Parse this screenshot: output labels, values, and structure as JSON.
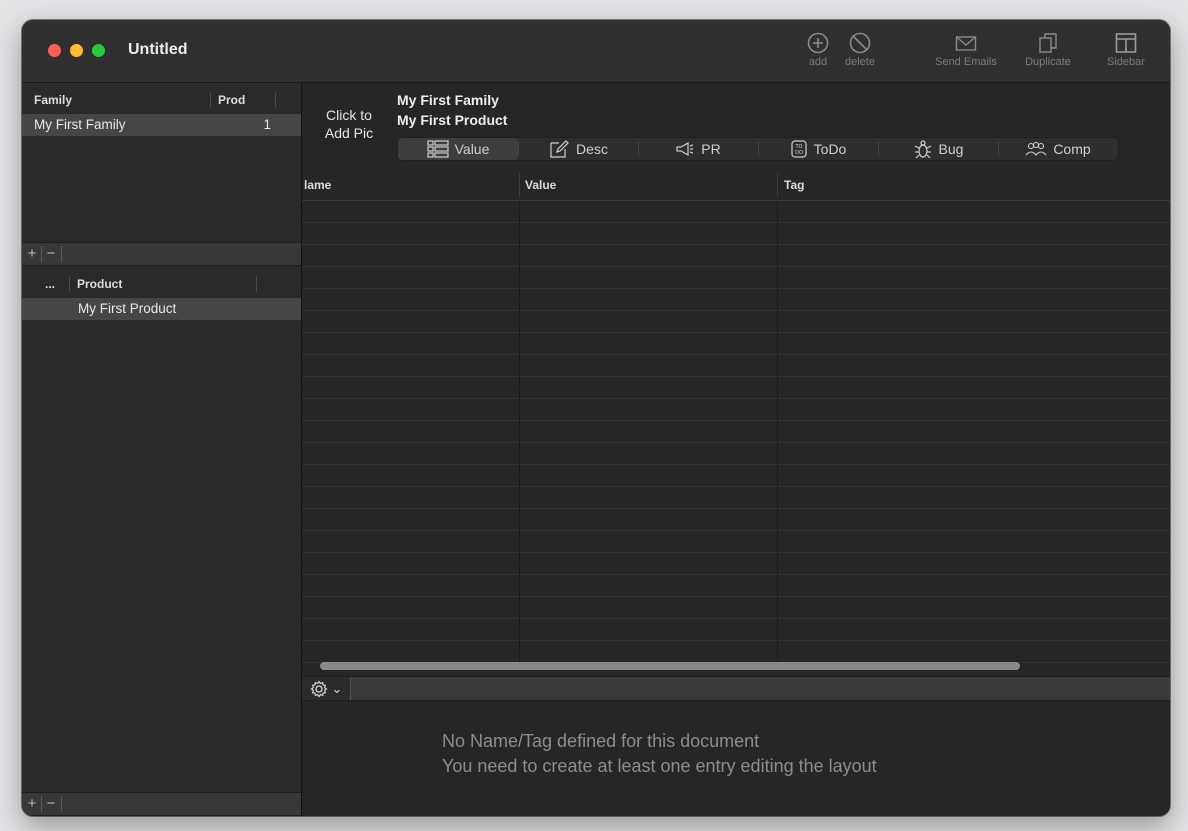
{
  "window": {
    "title": "Untitled"
  },
  "toolbar": {
    "add_label": "add",
    "delete_label": "delete",
    "send_emails_label": "Send Emails",
    "duplicate_label": "Duplicate",
    "sidebar_label": "Sidebar"
  },
  "family_table": {
    "col_family": "Family",
    "col_prod": "Prod",
    "rows": [
      {
        "name": "My First Family",
        "count": "1"
      }
    ]
  },
  "product_table": {
    "col_marker": "...",
    "col_product": "Product",
    "rows": [
      {
        "name": "My First Product"
      }
    ]
  },
  "pm": {
    "add": "+",
    "remove": "−"
  },
  "header": {
    "click_pic_line1": "Click to",
    "click_pic_line2": "Add Pic",
    "family_name": "My First Family",
    "product_name": "My First Product"
  },
  "tabs": [
    {
      "label": "Value",
      "icon": "list-icon"
    },
    {
      "label": "Desc",
      "icon": "pencil-icon"
    },
    {
      "label": "PR",
      "icon": "megaphone-icon"
    },
    {
      "label": "ToDo",
      "icon": "todo-icon"
    },
    {
      "label": "Bug",
      "icon": "bug-icon"
    },
    {
      "label": "Comp",
      "icon": "people-icon"
    }
  ],
  "grid": {
    "col_name": "lame",
    "col_value": "Value",
    "col_tag": "Tag"
  },
  "empty_message": {
    "line1": "No Name/Tag defined for this document",
    "line2": "You need to create at least one entry editing the layout"
  },
  "gear_menu": {
    "chevron": "⌄"
  }
}
